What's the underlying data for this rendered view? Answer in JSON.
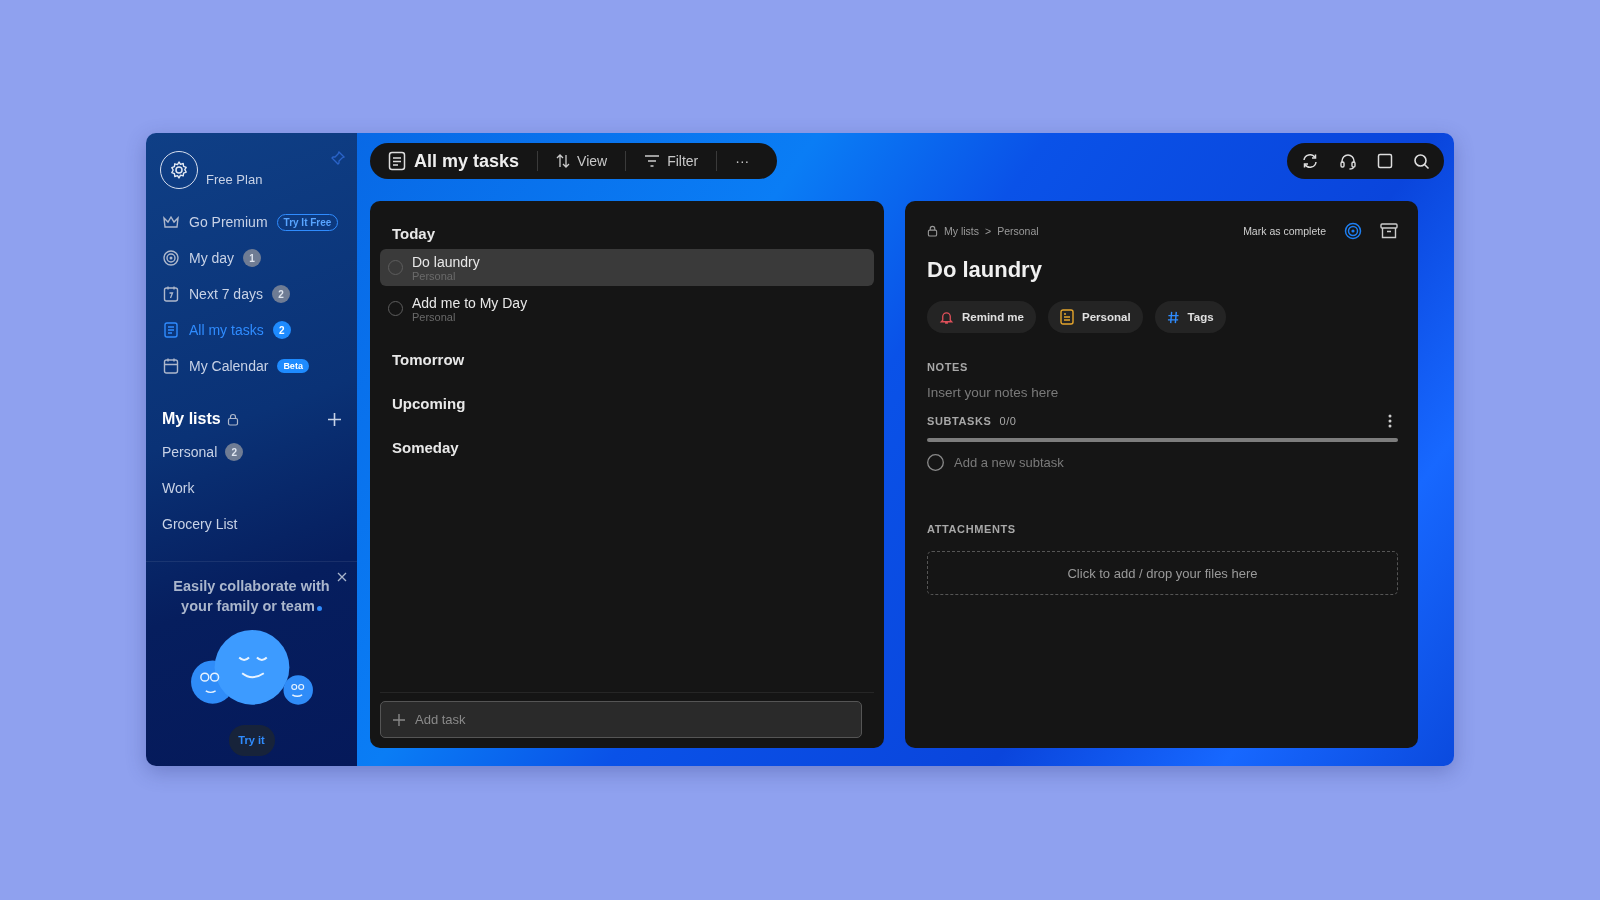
{
  "sidebar": {
    "plan": "Free Plan",
    "nav": [
      {
        "kind": "premium",
        "label": "Go Premium",
        "badge": "Try It Free",
        "selected": false
      },
      {
        "kind": "myday",
        "label": "My day",
        "badge": "1",
        "selected": false
      },
      {
        "kind": "next7",
        "label": "Next 7 days",
        "badge": "2",
        "selected": false
      },
      {
        "kind": "alltasks",
        "label": "All my tasks",
        "badge": "2",
        "selected": true
      },
      {
        "kind": "calendar",
        "label": "My Calendar",
        "badge": "Beta",
        "selected": false
      }
    ],
    "lists_title": "My lists",
    "lists": [
      {
        "label": "Personal",
        "badge": "2"
      },
      {
        "label": "Work"
      },
      {
        "label": "Grocery List"
      }
    ],
    "promo": {
      "text": "Easily collaborate with your family or team",
      "button": "Try it"
    }
  },
  "toolbar": {
    "title": "All my tasks",
    "view": "View",
    "filter": "Filter",
    "more": "···"
  },
  "task_groups": [
    {
      "title": "Today",
      "tasks": [
        {
          "title": "Do laundry",
          "list": "Personal",
          "selected": true
        },
        {
          "title": "Add me to My Day",
          "list": "Personal",
          "selected": false
        }
      ]
    },
    {
      "title": "Tomorrow"
    },
    {
      "title": "Upcoming"
    },
    {
      "title": "Someday"
    }
  ],
  "add_task": {
    "placeholder": "Add task"
  },
  "detail": {
    "breadcrumb": [
      "My lists",
      "Personal"
    ],
    "separator": ">",
    "mark_complete": "Mark as complete",
    "title": "Do laundry",
    "chips": [
      {
        "kind": "remind",
        "label": "Remind me"
      },
      {
        "kind": "list",
        "label": "Personal"
      },
      {
        "kind": "tags",
        "label": "Tags"
      }
    ],
    "notes_label": "NOTES",
    "notes_placeholder": "Insert your notes here",
    "subtasks_label": "SUBTASKS",
    "subtasks_count": "0/0",
    "subtask_placeholder": "Add a new subtask",
    "attachments_label": "ATTACHMENTS",
    "dropzone": "Click to add / drop your files here"
  }
}
